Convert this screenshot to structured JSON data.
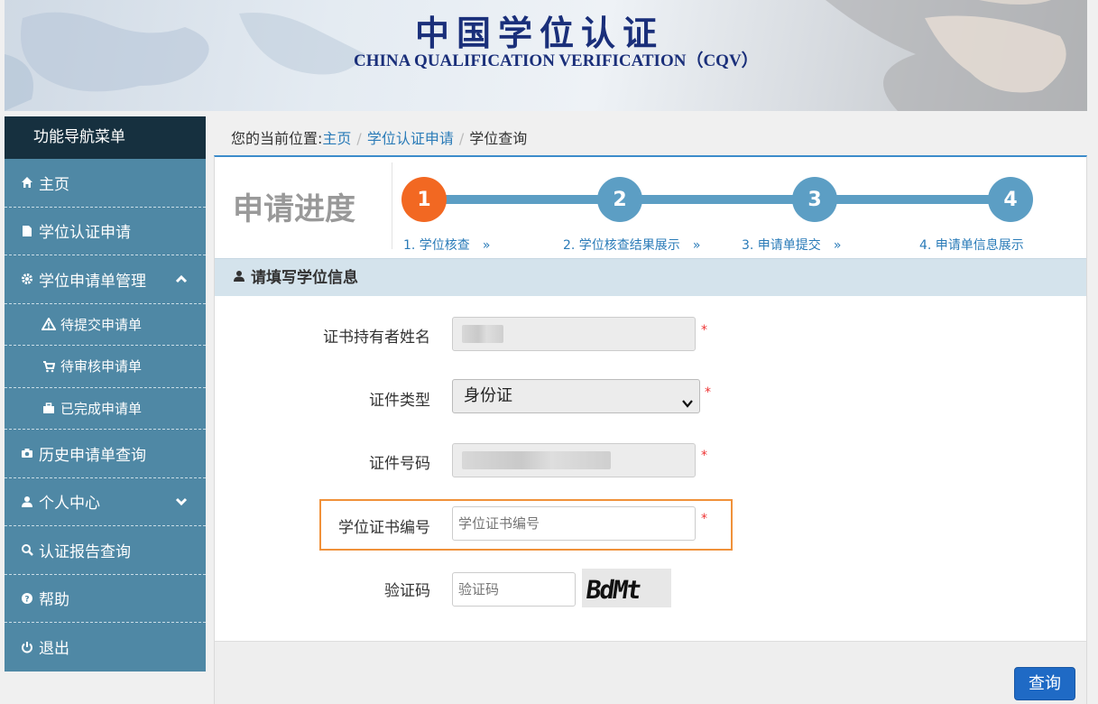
{
  "banner": {
    "title_cn": "中国学位认证",
    "title_en": "CHINA QUALIFICATION VERIFICATION（CQV）"
  },
  "sidebar": {
    "heading": "功能导航菜单",
    "items": [
      {
        "label": "主页",
        "icon": "home-icon"
      },
      {
        "label": "学位认证申请",
        "icon": "file-icon"
      },
      {
        "label": "学位申请单管理",
        "icon": "gear-icon",
        "expanded": true
      },
      {
        "label": "待提交申请单",
        "icon": "warning-icon"
      },
      {
        "label": "待审核申请单",
        "icon": "cart-icon"
      },
      {
        "label": "已完成申请单",
        "icon": "briefcase-icon"
      },
      {
        "label": "历史申请单查询",
        "icon": "camera-icon"
      },
      {
        "label": "个人中心",
        "icon": "user-icon",
        "expanded": false
      },
      {
        "label": "认证报告查询",
        "icon": "search-icon"
      },
      {
        "label": "帮助",
        "icon": "help-icon"
      },
      {
        "label": "退出",
        "icon": "power-icon"
      }
    ]
  },
  "breadcrumb": {
    "prefix": "您的当前位置:",
    "home": "主页",
    "parent": "学位认证申请",
    "current": "学位查询",
    "separator": "/"
  },
  "progress": {
    "title": "申请进度",
    "steps": [
      {
        "number": "1",
        "label": "1. 学位核查",
        "arrow": "»",
        "active": true
      },
      {
        "number": "2",
        "label": "2. 学位核查结果展示",
        "arrow": "»",
        "active": false
      },
      {
        "number": "3",
        "label": "3. 申请单提交",
        "arrow": "»",
        "active": false
      },
      {
        "number": "4",
        "label": "4. 申请单信息展示",
        "arrow": "",
        "active": false
      }
    ],
    "colors": {
      "active": "#f26822",
      "inactive": "#5c9ec4"
    }
  },
  "form": {
    "section_title": "请填写学位信息",
    "required_mark": "*",
    "holder_name_label": "证书持有者姓名",
    "id_type_label": "证件类型",
    "id_type_value": "身份证",
    "id_number_label": "证件号码",
    "cert_number_label": "学位证书编号",
    "cert_number_placeholder": "学位证书编号",
    "captcha_label": "验证码",
    "captcha_placeholder": "验证码",
    "captcha_text": "BdMt",
    "submit_label": "查询"
  }
}
